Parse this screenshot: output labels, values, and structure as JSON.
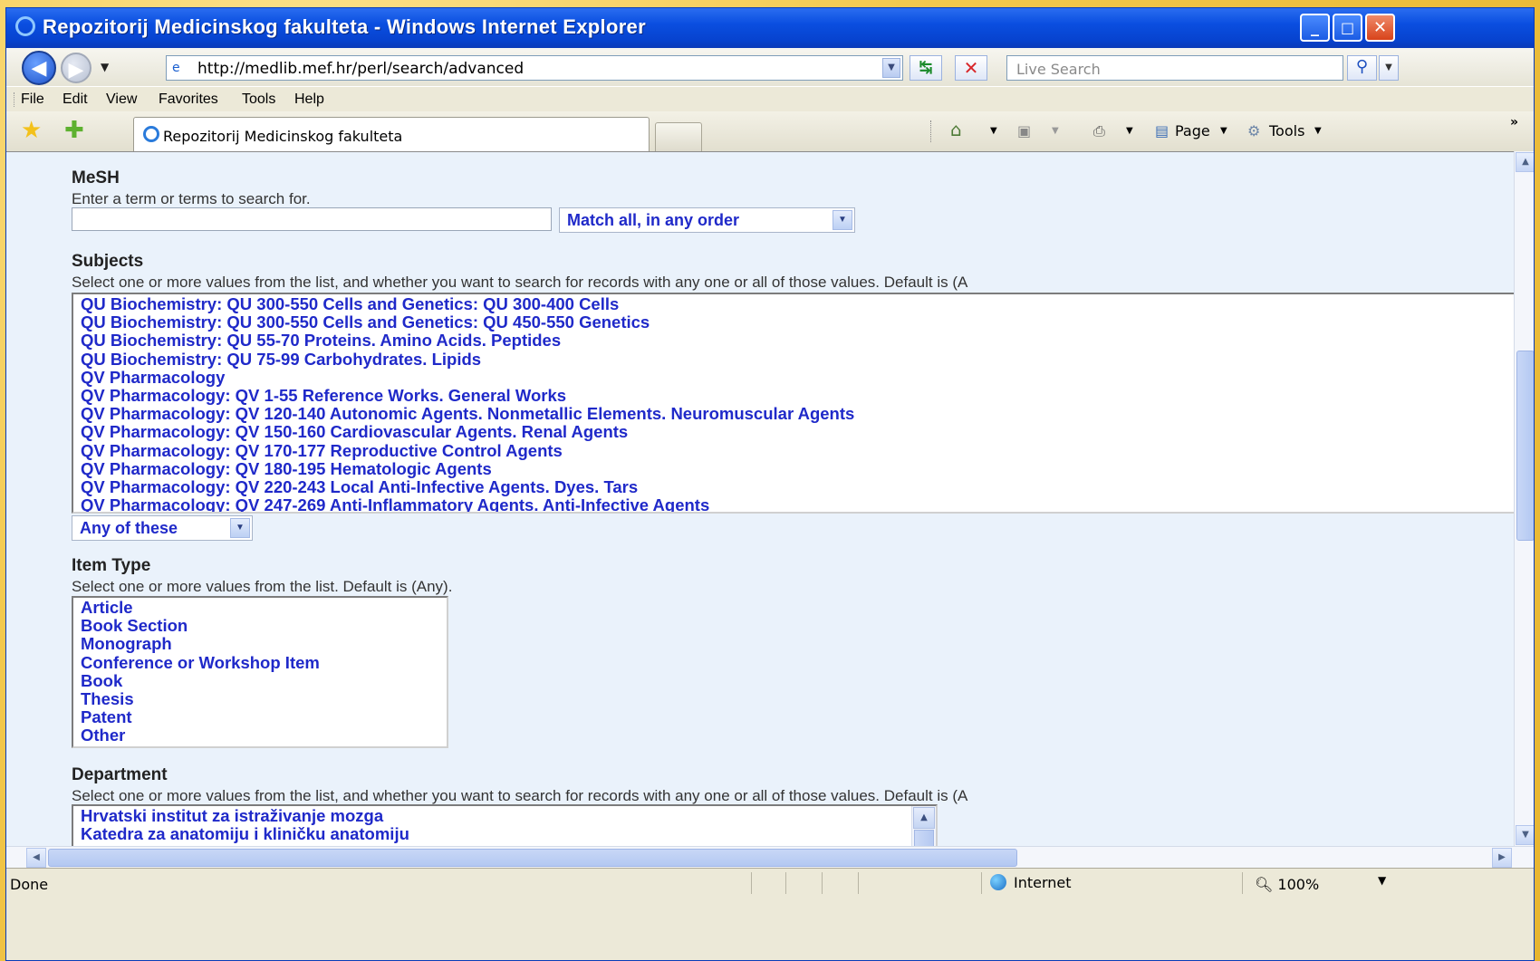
{
  "window": {
    "title": "Repozitorij Medicinskog fakulteta - Windows Internet Explorer",
    "minimize": "_",
    "maximize": "□",
    "close": "✕"
  },
  "address_bar": {
    "url": "http://medlib.mef.hr/perl/search/advanced",
    "live_search_placeholder": "Live Search"
  },
  "menu": [
    "File",
    "Edit",
    "View",
    "Favorites",
    "Tools",
    "Help"
  ],
  "tabs": [
    {
      "label": "Repozitorij Medicinskog fakulteta"
    }
  ],
  "command_bar": {
    "page_label": "Page",
    "tools_label": "Tools"
  },
  "form": {
    "mesh": {
      "title": "MeSH",
      "help": "Enter a term or terms to search for.",
      "value": "",
      "match_option": "Match all, in any order"
    },
    "subjects": {
      "title": "Subjects",
      "help": "Select one or more values from the list, and whether you want to search for records with any one or all of those values. Default is (A",
      "options": [
        "QU Biochemistry: QU 300-550 Cells and Genetics: QU 300-400 Cells",
        "QU Biochemistry: QU 300-550 Cells and Genetics: QU 450-550 Genetics",
        "QU Biochemistry: QU 55-70 Proteins. Amino Acids. Peptides",
        "QU Biochemistry: QU 75-99 Carbohydrates. Lipids",
        "QV Pharmacology",
        "QV Pharmacology: QV 1-55 Reference Works. General Works",
        "QV Pharmacology: QV 120-140 Autonomic Agents. Nonmetallic Elements. Neuromuscular Agents",
        "QV Pharmacology: QV 150-160 Cardiovascular Agents. Renal Agents",
        "QV Pharmacology: QV 170-177 Reproductive Control Agents",
        "QV Pharmacology: QV 180-195 Hematologic Agents",
        "QV Pharmacology: QV 220-243 Local Anti-Infective Agents. Dyes. Tars",
        "QV Pharmacology: QV 247-269 Anti-Inflammatory Agents. Anti-Infective Agents"
      ],
      "match_option": "Any of these"
    },
    "item_type": {
      "title": "Item Type",
      "help": "Select one or more values from the list. Default is (Any).",
      "options": [
        "Article",
        "Book Section",
        "Monograph",
        "Conference or Workshop Item",
        "Book",
        "Thesis",
        "Patent",
        "Other"
      ]
    },
    "department": {
      "title": "Department",
      "help": "Select one or more values from the list, and whether you want to search for records with any one or all of those values. Default is (A",
      "options": [
        "Hrvatski institut za istraživanje mozga",
        "Katedra za anatomiju i kliničku anatomiju"
      ]
    }
  },
  "status_bar": {
    "status": "Done",
    "zone": "Internet",
    "zoom": "100%"
  },
  "colors": {
    "title_bar": "#0a4ee0",
    "link_blue": "#1f29c9",
    "content_bg": "#eaf2fb",
    "frame": "#f2c84b"
  }
}
